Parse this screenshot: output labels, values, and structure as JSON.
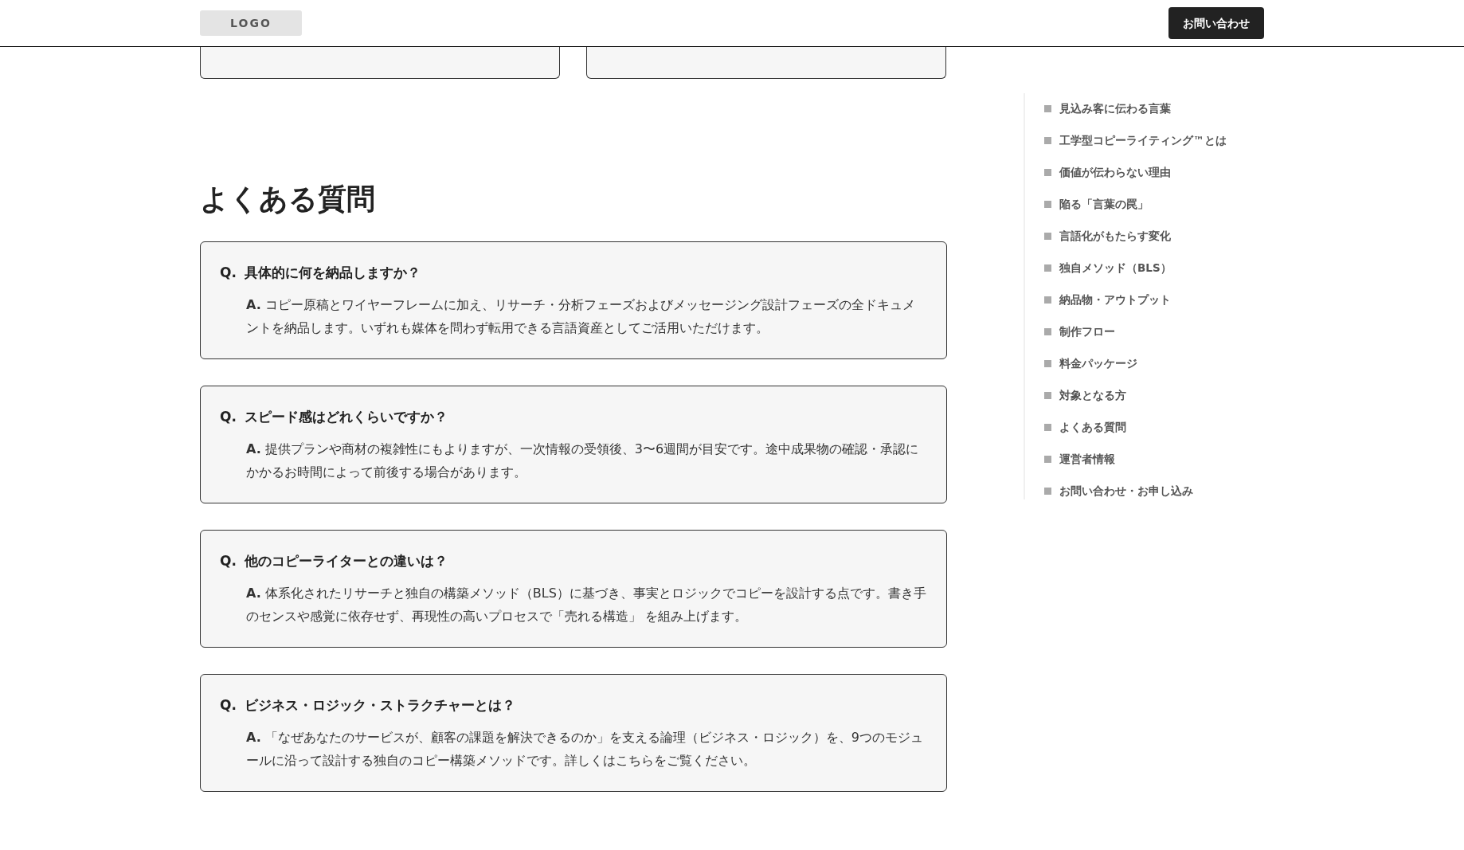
{
  "header": {
    "logo": "LOGO",
    "contact_button": "お問い合わせ"
  },
  "faq": {
    "title": "よくある質問",
    "items": [
      {
        "q_mark": "Q.",
        "question": "具体的に何を納品しますか？",
        "answer": "**A.** コピー原稿とワイヤーフレームに加え、リサーチ・分析フェーズおよびメッセージング設計フェーズの全ドキュメントを納品します。いずれも媒体を問わず転用できる言語資産としてご活用いただけます。"
      },
      {
        "q_mark": "Q.",
        "question": "スピード感はどれくらいですか？",
        "answer": "**A.** 提供プランや商材の複雑性にもよりますが、一次情報の受領後、3〜6週間が目安です。途中成果物の確認・承認にかかるお時間によって前後する場合があります。"
      },
      {
        "q_mark": "Q.",
        "question": "他のコピーライターとの違いは？",
        "answer": "**A.** 体系化されたリサーチと独自の構築メソッド（BLS）に基づき、事実とロジックでコピーを設計する点です。書き手のセンスや感覚に依存せず、再現性の高いプロセスで「売れる構造」 を組み上げます。"
      },
      {
        "q_mark": "Q.",
        "question": "ビジネス・ロジック・ストラクチャーとは？",
        "answer": "**A.** 「なぜあなたのサービスが、顧客の課題を解決できるのか」を支える論理（ビジネス・ロジック）を、9つのモジュールに沿って設計する独自のコピー構築メソッドです。詳しくはこちらをご覧ください。"
      }
    ]
  },
  "toc": [
    "見込み客に伝わる言葉",
    "工学型コピーライティング™とは",
    "価値が伝わらない理由",
    "陥る「言葉の罠」",
    "言語化がもたらす変化",
    "独自メソッド（BLS）",
    "納品物・アウトプット",
    "制作フロー",
    "料金パッケージ",
    "対象となる方",
    "よくある質問",
    "運営者情報",
    "お問い合わせ・お申し込み"
  ]
}
